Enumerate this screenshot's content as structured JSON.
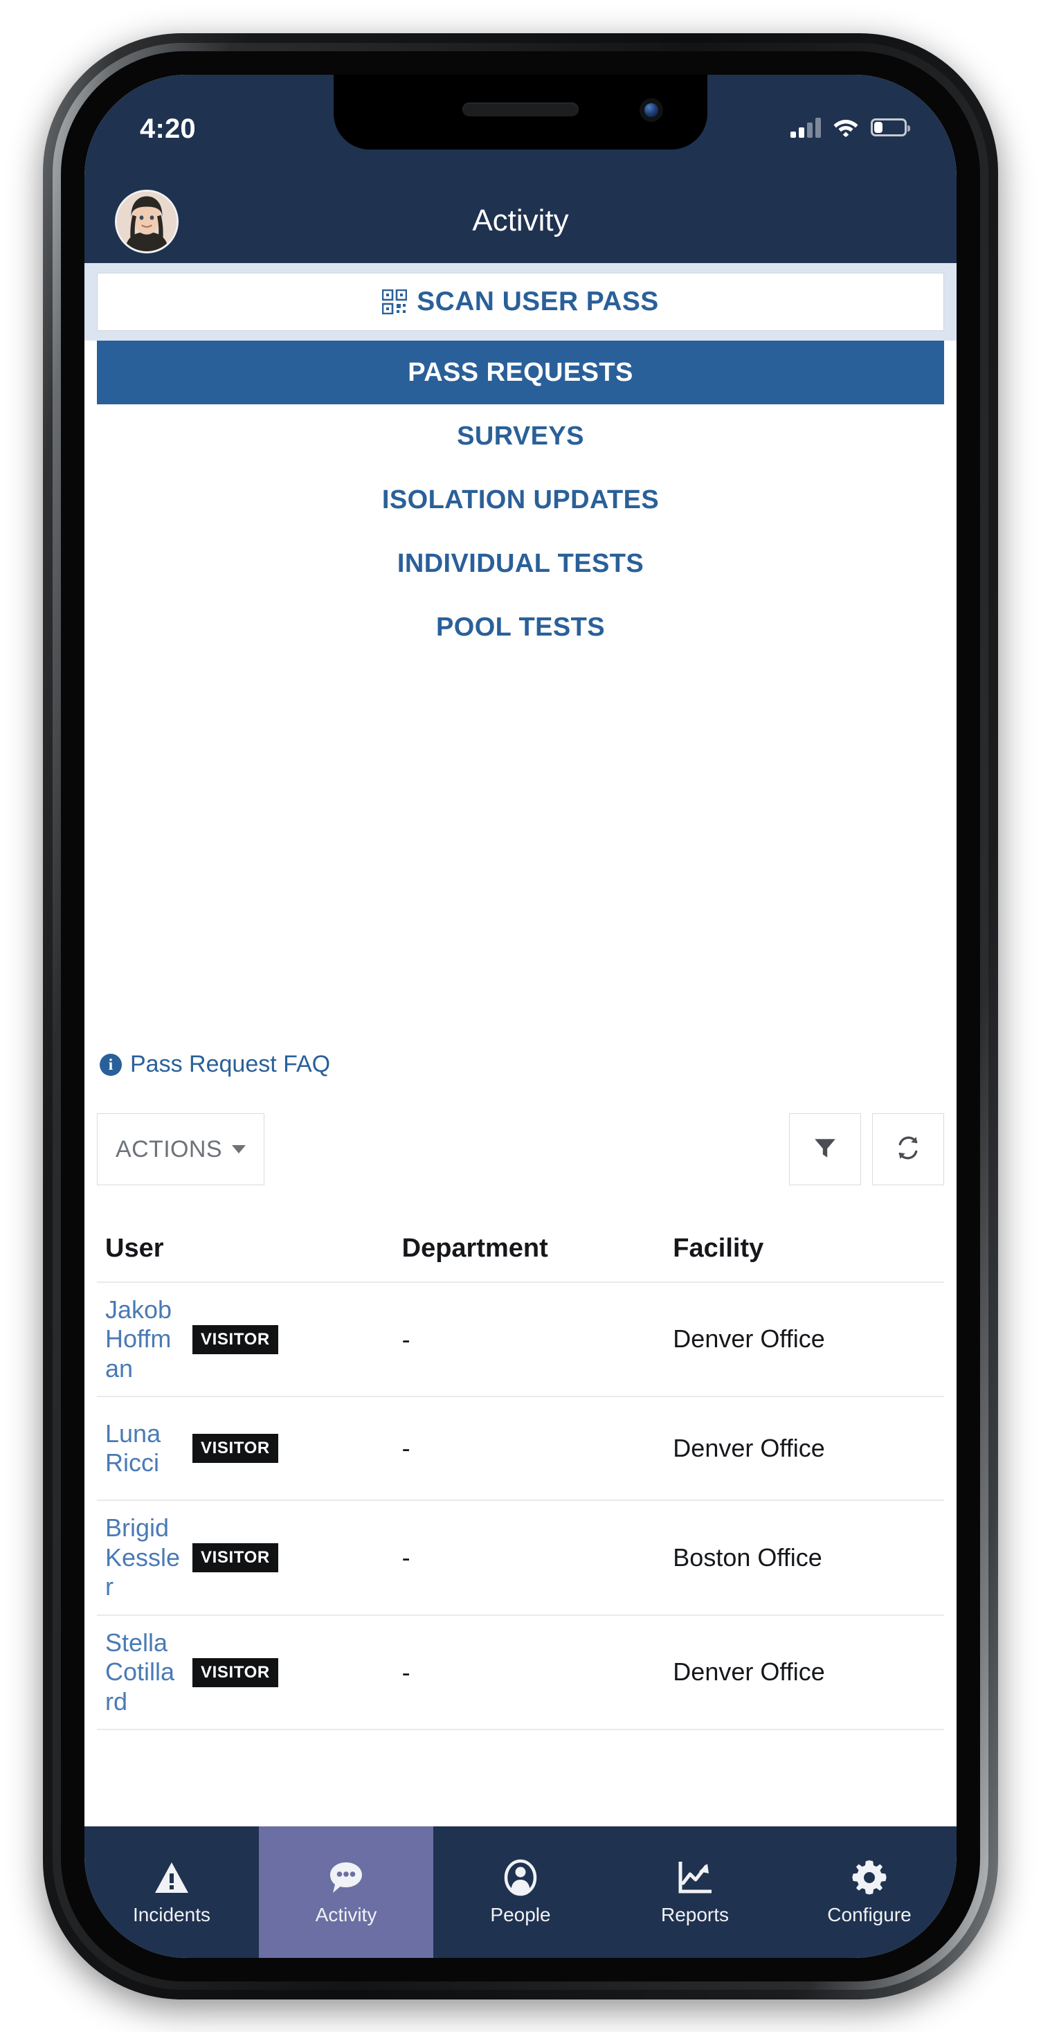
{
  "status_bar": {
    "time": "4:20",
    "signal_icon": "cellular-signal-icon",
    "wifi_icon": "wifi-icon",
    "battery_icon": "battery-icon",
    "battery_level_pct": 26
  },
  "header": {
    "title": "Activity",
    "avatar_icon": "user-avatar"
  },
  "scan": {
    "label": "SCAN USER PASS",
    "icon": "qr-code-icon"
  },
  "tabs": [
    {
      "label": "PASS REQUESTS",
      "active": true
    },
    {
      "label": "SURVEYS",
      "active": false
    },
    {
      "label": "ISOLATION UPDATES",
      "active": false
    },
    {
      "label": "INDIVIDUAL TESTS",
      "active": false
    },
    {
      "label": "POOL TESTS",
      "active": false
    }
  ],
  "faq": {
    "label": "Pass Request FAQ",
    "icon": "info-icon"
  },
  "toolbar": {
    "actions_label": "ACTIONS",
    "filter_icon": "filter-funnel-icon",
    "refresh_icon": "refresh-icon"
  },
  "table": {
    "columns": [
      "User",
      "Department",
      "Facility"
    ],
    "rows": [
      {
        "user": "Jakob Hoffman",
        "badge": "VISITOR",
        "department": "-",
        "facility": "Denver Office"
      },
      {
        "user": "Luna Ricci",
        "badge": "VISITOR",
        "department": "-",
        "facility": "Denver Office"
      },
      {
        "user": "Brigid Kessler",
        "badge": "VISITOR",
        "department": "-",
        "facility": "Boston Office"
      },
      {
        "user": "Stella Cotillard",
        "badge": "VISITOR",
        "department": "-",
        "facility": "Denver Office"
      }
    ]
  },
  "bottom_nav": [
    {
      "label": "Incidents",
      "icon": "warning-triangle-icon",
      "active": false
    },
    {
      "label": "Activity",
      "icon": "chat-bubble-icon",
      "active": true
    },
    {
      "label": "People",
      "icon": "person-icon",
      "active": false
    },
    {
      "label": "Reports",
      "icon": "chart-line-icon",
      "active": false
    },
    {
      "label": "Configure",
      "icon": "gear-icon",
      "active": false
    }
  ],
  "colors": {
    "header_navy": "#1f3250",
    "accent_blue": "#2a6099",
    "active_nav": "#6b6fa3",
    "link_blue": "#4a7ab5",
    "badge_black": "#111214",
    "scanbar_bg": "#dce5ef"
  }
}
